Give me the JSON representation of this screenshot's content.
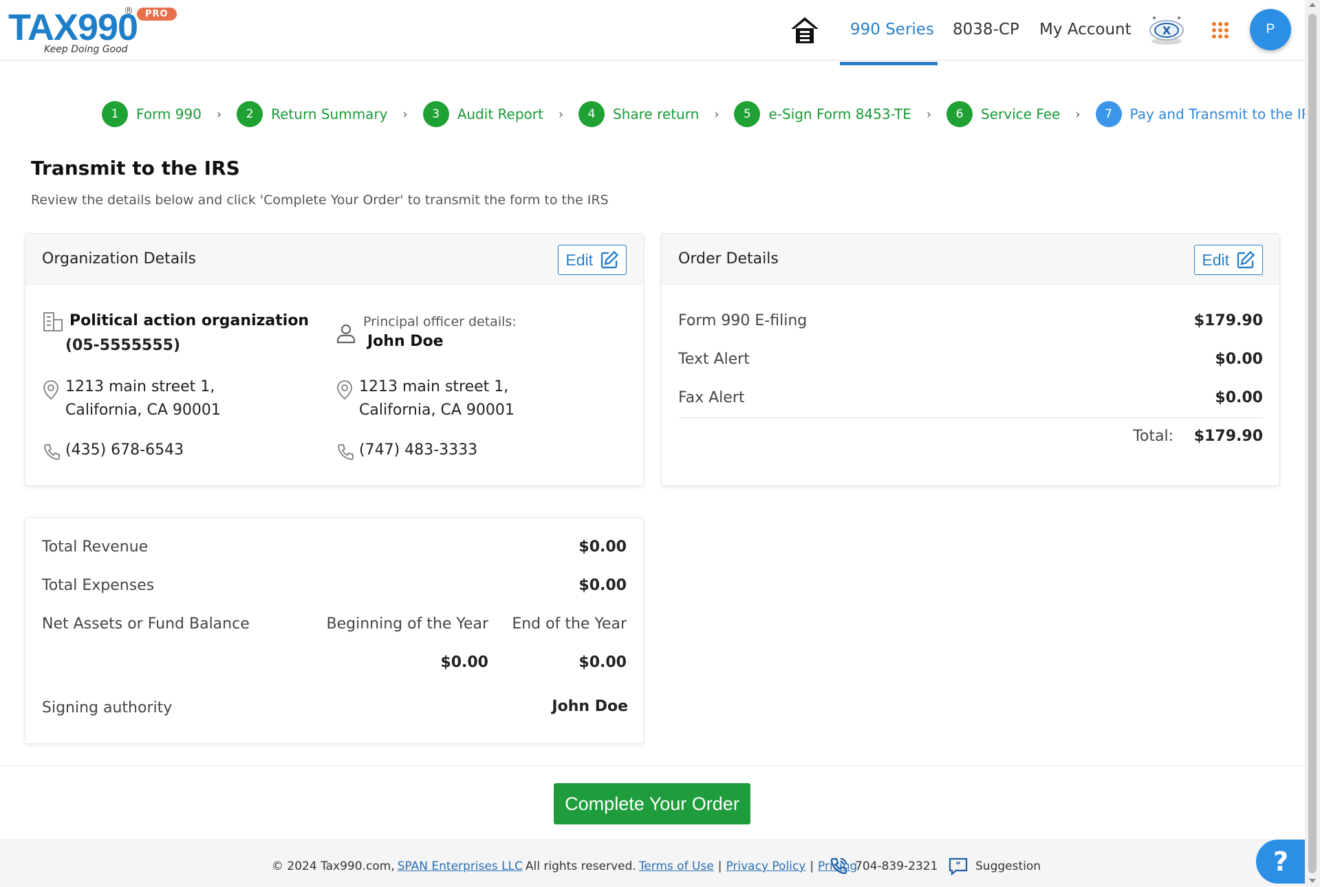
{
  "brand": {
    "logo_text": "TAX990",
    "registered": "®",
    "pro_badge": "PRO",
    "tagline": "Keep Doing Good"
  },
  "nav": {
    "home_icon": "home-icon",
    "links": [
      "990 Series",
      "8038-CP",
      "My Account"
    ],
    "active_link": "990 Series",
    "avatar_initial": "P",
    "accent_color": "#2a7fc6"
  },
  "stepper": {
    "steps": [
      {
        "num": "1",
        "label": "Form 990"
      },
      {
        "num": "2",
        "label": "Return Summary"
      },
      {
        "num": "3",
        "label": "Audit Report"
      },
      {
        "num": "4",
        "label": "Share return"
      },
      {
        "num": "5",
        "label": "e-Sign Form 8453-TE"
      },
      {
        "num": "6",
        "label": "Service Fee"
      },
      {
        "num": "7",
        "label": "Pay and Transmit to the IRS"
      }
    ],
    "current_step": "7",
    "done_color": "#1fa134",
    "current_color": "#3b95e8"
  },
  "page": {
    "title": "Transmit to the IRS",
    "subtitle": "Review the details below and click 'Complete Your Order' to transmit the form to the IRS"
  },
  "org_card": {
    "title": "Organization Details",
    "edit_label": "Edit",
    "org_name": "Political action organization",
    "ein": "(05-5555555)",
    "org_address_line1": "1213 main street 1,",
    "org_address_line2": "California, CA 90001",
    "org_phone": "(435) 678-6543",
    "officer_caption": "Principal officer details:",
    "officer_name": "John Doe",
    "officer_address_line1": "1213 main street 1,",
    "officer_address_line2": "California, CA 90001",
    "officer_phone": "(747) 483-3333"
  },
  "order_card": {
    "title": "Order Details",
    "edit_label": "Edit",
    "items": [
      {
        "label": "Form 990 E-filing",
        "amount": "$179.90"
      },
      {
        "label": "Text Alert",
        "amount": "$0.00"
      },
      {
        "label": "Fax Alert",
        "amount": "$0.00"
      }
    ],
    "total_label": "Total:",
    "total_amount": "$179.90"
  },
  "summary_card": {
    "total_revenue_label": "Total Revenue",
    "total_revenue": "$0.00",
    "total_expenses_label": "Total Expenses",
    "total_expenses": "$0.00",
    "net_assets_label": "Net Assets or Fund Balance",
    "beginning_label": "Beginning of the Year",
    "end_label": "End of the Year",
    "beginning_value": "$0.00",
    "end_value": "$0.00",
    "signing_label": "Signing authority",
    "signing_name": "John Doe"
  },
  "actions": {
    "complete_label": "Complete Your Order",
    "complete_color": "#1f9c3c"
  },
  "footer": {
    "copyright": "© 2024 Tax990.com,",
    "company_link": "SPAN Enterprises LLC",
    "rights": "All rights reserved.",
    "terms": "Terms of Use",
    "privacy": "Privacy Policy",
    "pricing": "Pricing",
    "phone": "704-839-2321",
    "suggestion": "Suggestion",
    "help_glyph": "?"
  }
}
